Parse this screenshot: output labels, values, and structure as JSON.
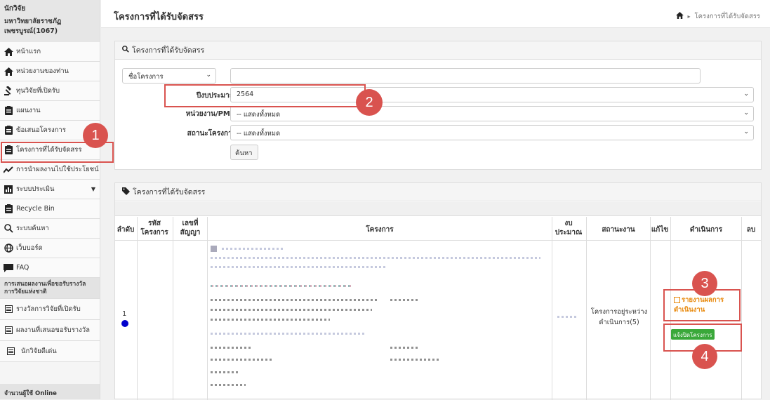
{
  "sidebar": {
    "role": "นักวิจัย",
    "org": "มหาวิทยาลัยราชภัฏเพชรบูรณ์(1067)",
    "items": [
      {
        "label": "หน้าแรก",
        "icon": "home-icon"
      },
      {
        "label": "หน่วยงานของท่าน",
        "icon": "home-icon"
      },
      {
        "label": "ทุนวิจัยที่เปิดรับ",
        "icon": "gavel-icon"
      },
      {
        "label": "แผนงาน",
        "icon": "clipboard-icon"
      },
      {
        "label": "ข้อเสนอโครงการ",
        "icon": "clipboard-icon"
      },
      {
        "label": "โครงการที่ได้รับจัดสรร",
        "icon": "clipboard-icon"
      },
      {
        "label": "การนำผลงานไปใช้ประโยชน์",
        "icon": "chart-line-icon"
      },
      {
        "label": "ระบบประเมิน",
        "icon": "bar-chart-icon"
      },
      {
        "label": "Recycle Bin",
        "icon": "clipboard-icon"
      },
      {
        "label": "ระบบค้นหา",
        "icon": "search-icon"
      },
      {
        "label": "เว็บบอร์ด",
        "icon": "globe-icon"
      },
      {
        "label": "FAQ",
        "icon": "comment-icon"
      }
    ],
    "section_title": "การเสนอผลงานเพื่อขอรับรางวัลการวิจัยแห่งชาติ",
    "award_items": [
      {
        "label": "รางวัลการวิจัยที่เปิดรับ"
      },
      {
        "label": "ผลงานที่เสนอขอรับรางวัล"
      },
      {
        "label": "นักวิจัยดีเด่น"
      }
    ],
    "footer": "จำนวนผู้ใช้ Online"
  },
  "header": {
    "title": "โครงการที่ได้รับจัดสรร",
    "breadcrumb": "โครงการที่ได้รับจัดสรร"
  },
  "search_panel": {
    "title": "โครงการที่ได้รับจัดสรร",
    "field_select": "ชื่อโครงการ",
    "text_value": "",
    "year_label": "ปีงบประมาณ",
    "year_value": "2564",
    "unit_label": "หน่วยงาน/PMU",
    "unit_value": "-- แสดงทั้งหมด",
    "status_label": "สถานะโครงการ",
    "status_value": "-- แสดงทั้งหมด",
    "search_button": "ค้นหา"
  },
  "results_panel": {
    "title": "โครงการที่ได้รับจัดสรร",
    "columns": [
      "ลำดับ",
      "รหัสโครงการ",
      "เลขที่สัญญา",
      "โครงการ",
      "งบประมาณ",
      "สถานะงาน",
      "แก้ไข",
      "ดำเนินการ",
      "ลบ"
    ],
    "row": {
      "index": "1",
      "status": "โครงการอยู่ระหว่างดำเนินการ(5)",
      "report_link": "รายงานผลการดำเนินงาน",
      "close_button": "แจ้งปิดโครงการ"
    }
  },
  "annotations": [
    "1",
    "2",
    "3",
    "4"
  ],
  "colors": {
    "highlight": "#d9534f",
    "link_orange": "#e8890c",
    "button_green": "#3aa83a",
    "status_dot": "#0000cc"
  }
}
